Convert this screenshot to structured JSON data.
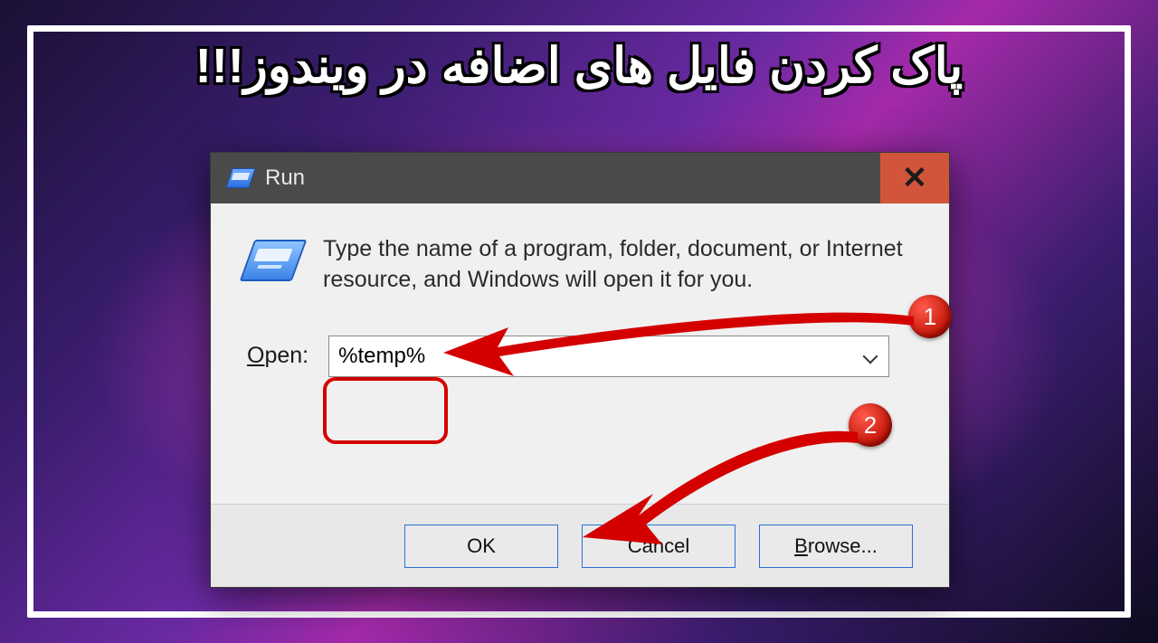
{
  "headline": "پاک کردن فایل های اضافه در ویندوز!!!",
  "dialog": {
    "title": "Run",
    "hint": "Type the name of a program, folder, document, or Internet resource, and Windows will open it for you.",
    "open_label_pre": "O",
    "open_label_rest": "pen:",
    "input_value": "%temp%",
    "buttons": {
      "ok": "OK",
      "cancel": "Cancel",
      "browse_pre": "B",
      "browse_rest": "rowse..."
    }
  },
  "annotations": {
    "step1": "1",
    "step2": "2"
  }
}
